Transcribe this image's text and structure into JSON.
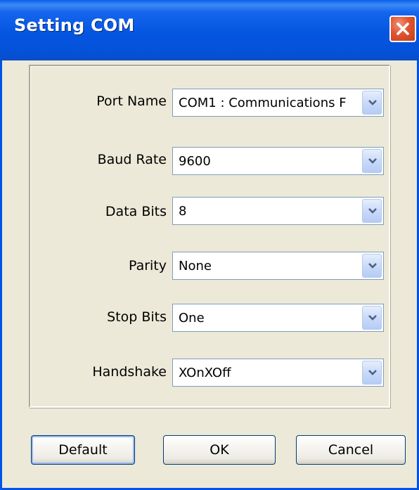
{
  "window": {
    "title": "Setting COM"
  },
  "form": {
    "fields": [
      {
        "label": "Port Name",
        "value": "COM1 : Communications F"
      },
      {
        "label": "Baud Rate",
        "value": "9600"
      },
      {
        "label": "Data Bits",
        "value": "8"
      },
      {
        "label": "Parity",
        "value": "None"
      },
      {
        "label": "Stop Bits",
        "value": "One"
      },
      {
        "label": "Handshake",
        "value": "XOnXOff"
      }
    ]
  },
  "buttons": {
    "default_label": "Default",
    "ok_label": "OK",
    "cancel_label": "Cancel"
  },
  "icons": {
    "close": "close-icon",
    "dropdown": "chevron-down-icon"
  },
  "colors": {
    "titlebar": "#0455E0",
    "window_bg": "#ECE9D8",
    "close_button": "#E0532F",
    "input_border": "#7F9DB9"
  }
}
